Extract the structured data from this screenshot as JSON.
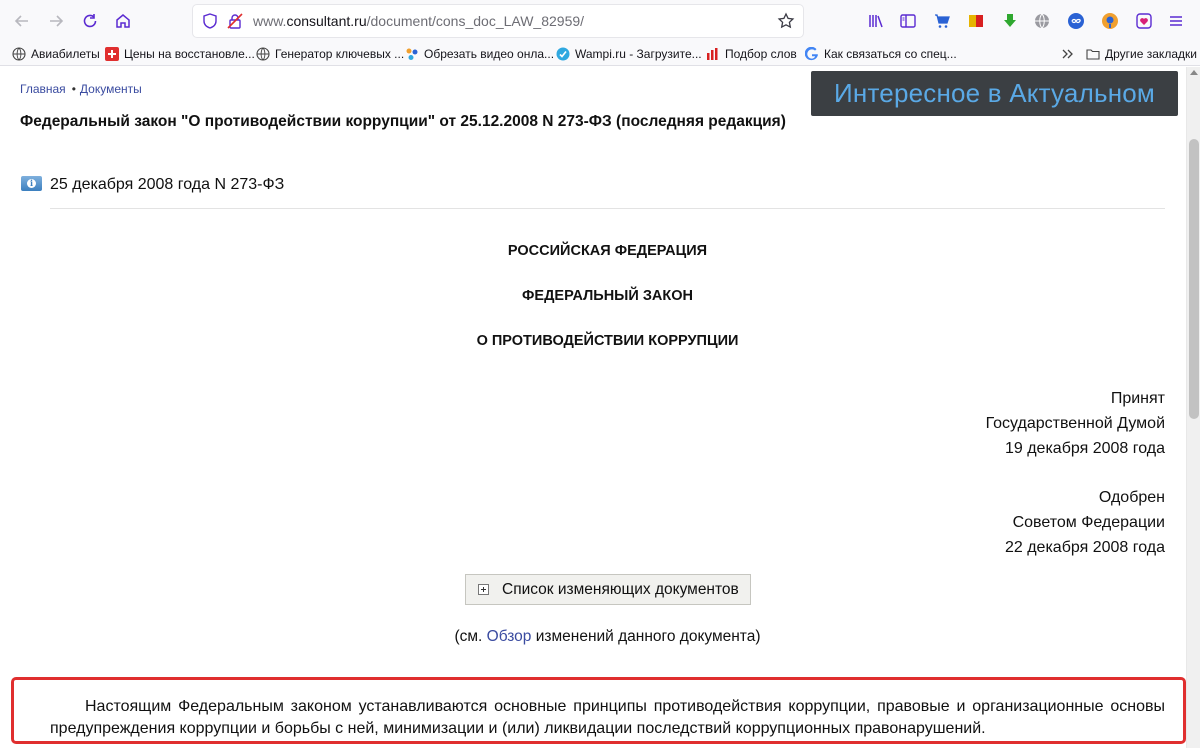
{
  "browser": {
    "url_prefix": "www.",
    "url_domain": "consultant.ru",
    "url_path": "/document/cons_doc_LAW_82959/",
    "bookmarks": [
      {
        "label": "Авиабилеты",
        "icon": "globe-icon"
      },
      {
        "label": "Цены на восстановле...",
        "icon": "red-plus-icon"
      },
      {
        "label": "Генератор ключевых ...",
        "icon": "globe-icon"
      },
      {
        "label": "Обрезать видео онла...",
        "icon": "dots-icon"
      },
      {
        "label": "Wampi.ru - Загрузите...",
        "icon": "wampi-icon"
      },
      {
        "label": "Подбор слов",
        "icon": "bars-icon"
      },
      {
        "label": "Как связаться со спец...",
        "icon": "google-icon"
      }
    ],
    "other_bookmarks": "Другие закладки"
  },
  "page": {
    "breadcrumbs": {
      "home": "Главная",
      "docs": "Документы"
    },
    "promo_text": "Интересное в Актуальном",
    "title": "Федеральный закон \"О противодействии коррупции\" от 25.12.2008 N 273-ФЗ (последняя редакция)",
    "doc_date": "25 декабря 2008 года N 273-ФЗ",
    "header_lines": [
      "РОССИЙСКАЯ ФЕДЕРАЦИЯ",
      "ФЕДЕРАЛЬНЫЙ ЗАКОН",
      "О ПРОТИВОДЕЙСТВИИ КОРРУПЦИИ"
    ],
    "adopted": [
      "Принят",
      "Государственной Думой",
      "19 декабря 2008 года"
    ],
    "approved": [
      "Одобрен",
      "Советом Федерации",
      "22 декабря 2008 года"
    ],
    "changes_button": "Список изменяющих документов",
    "see_prefix": "(см. ",
    "see_link": "Обзор",
    "see_suffix": " изменений данного документа)",
    "intro_paragraph": "Настоящим Федеральным законом устанавливаются основные принципы противодействия коррупции, правовые и организационные основы предупреждения коррупции и борьбы с ней, минимизации и (или) ликвидации последствий коррупционных правонарушений."
  },
  "colors": {
    "highlight_border": "#e02f2f",
    "link": "#3a4ba0",
    "promo_bg": "#3b3f43",
    "promo_text": "#5aa9e6"
  }
}
